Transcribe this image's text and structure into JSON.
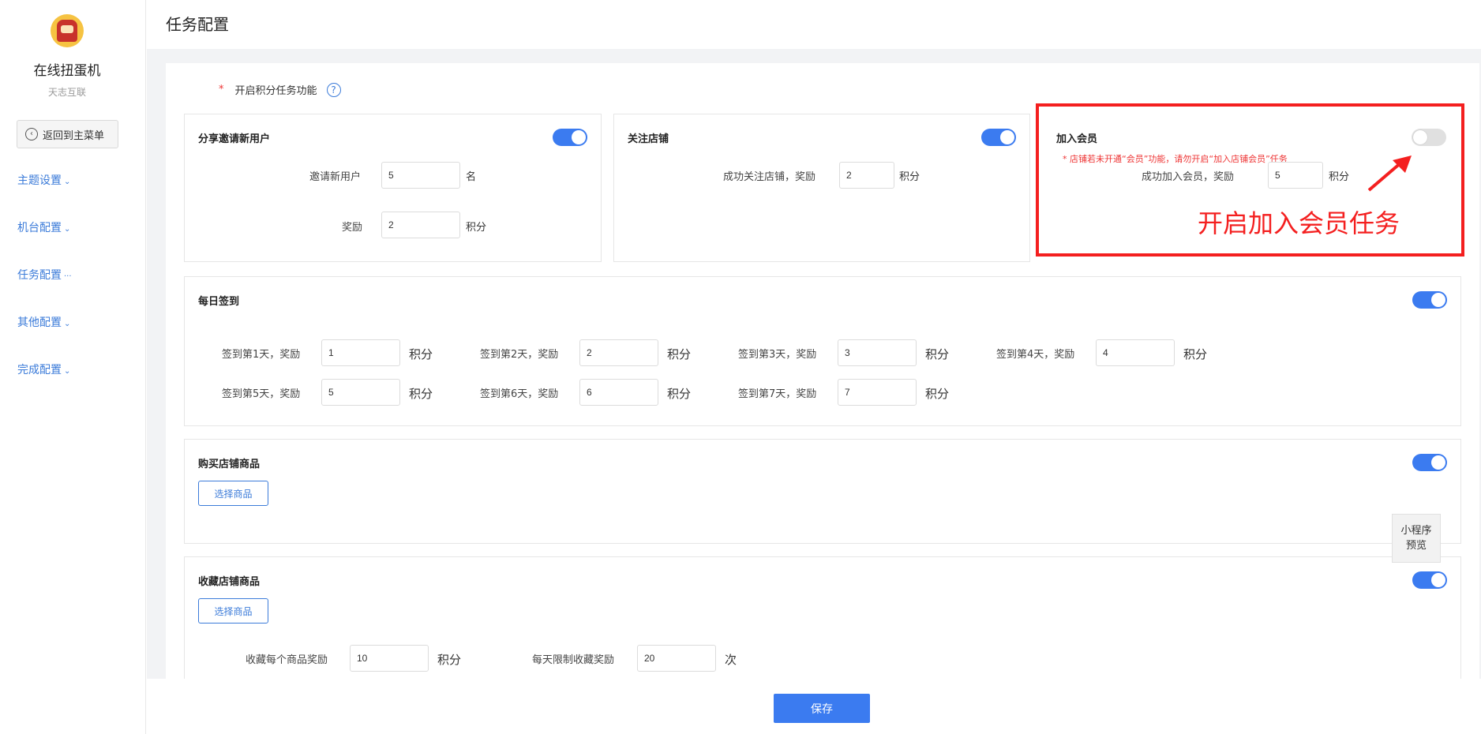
{
  "sidebar": {
    "app_name": "在线扭蛋机",
    "app_sub": "天志互联",
    "back_label": "返回到主菜单",
    "nav": [
      {
        "label": "主题设置",
        "suffix": "⌄"
      },
      {
        "label": "机台配置",
        "suffix": "⌄"
      },
      {
        "label": "任务配置",
        "suffix": "···"
      },
      {
        "label": "其他配置",
        "suffix": "⌄"
      },
      {
        "label": "完成配置",
        "suffix": "⌄"
      }
    ]
  },
  "page_title": "任务配置",
  "feature": {
    "required_mark": "*",
    "label": "开启积分任务功能",
    "help": "?"
  },
  "invite": {
    "title": "分享邀请新用户",
    "enabled": true,
    "invite_label": "邀请新用户",
    "invite_value": "5",
    "invite_unit": "名",
    "reward_label": "奖励",
    "reward_value": "2",
    "reward_unit": "积分"
  },
  "follow": {
    "title": "关注店铺",
    "enabled": true,
    "label": "成功关注店铺，奖励",
    "value": "2",
    "unit": "积分"
  },
  "member": {
    "title": "加入会员",
    "enabled": false,
    "warning": "* 店铺若未开通“会员”功能，请勿开启“加入店铺会员”任务",
    "label": "成功加入会员，奖励",
    "value": "5",
    "unit": "积分"
  },
  "annotation": {
    "text": "开启加入会员任务",
    "color": "#f41f1f"
  },
  "checkin": {
    "title": "每日签到",
    "enabled": true,
    "unit": "积分",
    "days": [
      {
        "label": "签到第1天，奖励",
        "value": "1"
      },
      {
        "label": "签到第2天，奖励",
        "value": "2"
      },
      {
        "label": "签到第3天，奖励",
        "value": "3"
      },
      {
        "label": "签到第4天，奖励",
        "value": "4"
      },
      {
        "label": "签到第5天，奖励",
        "value": "5"
      },
      {
        "label": "签到第6天，奖励",
        "value": "6"
      },
      {
        "label": "签到第7天，奖励",
        "value": "7"
      }
    ]
  },
  "purchase": {
    "title": "购买店铺商品",
    "enabled": true,
    "select_label": "选择商品"
  },
  "collect": {
    "title": "收藏店铺商品",
    "enabled": true,
    "select_label": "选择商品",
    "per_item_label": "收藏每个商品奖励",
    "per_item_value": "10",
    "per_item_unit": "积分",
    "daily_limit_label": "每天限制收藏奖励",
    "daily_limit_value": "20",
    "daily_limit_unit": "次"
  },
  "preview": {
    "line1": "小程序",
    "line2": "预览"
  },
  "save_label": "保存",
  "colors": {
    "accent": "#3b7bf0",
    "link": "#3b7bd9",
    "warning": "#e33333",
    "annotation": "#f41f1f"
  }
}
